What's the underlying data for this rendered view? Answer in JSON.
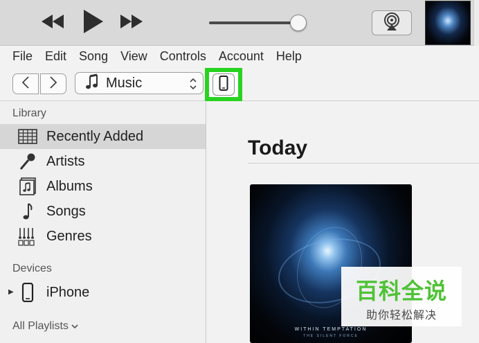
{
  "player": {
    "volume_level": 0.92,
    "icons": {
      "rewind": "rewind-icon",
      "play": "play-icon",
      "fast_forward": "fast-forward-icon",
      "airplay": "airplay-icon"
    }
  },
  "menu": [
    "File",
    "Edit",
    "Song",
    "View",
    "Controls",
    "Account",
    "Help"
  ],
  "nav": {
    "media_kind": "Music",
    "media_icon": "music-note-icon",
    "device_icon": "iphone-icon",
    "highlight_color": "#28d320"
  },
  "sidebar": {
    "library_heading": "Library",
    "library_items": [
      {
        "label": "Recently Added",
        "icon": "grid-icon",
        "selected": true
      },
      {
        "label": "Artists",
        "icon": "microphone-icon",
        "selected": false
      },
      {
        "label": "Albums",
        "icon": "album-icon",
        "selected": false
      },
      {
        "label": "Songs",
        "icon": "note-icon",
        "selected": false
      },
      {
        "label": "Genres",
        "icon": "genres-icon",
        "selected": false
      }
    ],
    "devices_heading": "Devices",
    "devices": [
      {
        "label": "iPhone",
        "icon": "iphone-icon"
      }
    ],
    "playlists_heading": "All Playlists"
  },
  "main": {
    "section_title": "Today",
    "album": {
      "title": "WITHIN TEMPTATION",
      "subtitle": "THE SILENT FORCE"
    }
  },
  "watermark": {
    "main": "百科全说",
    "sub": "助你轻松解决"
  }
}
